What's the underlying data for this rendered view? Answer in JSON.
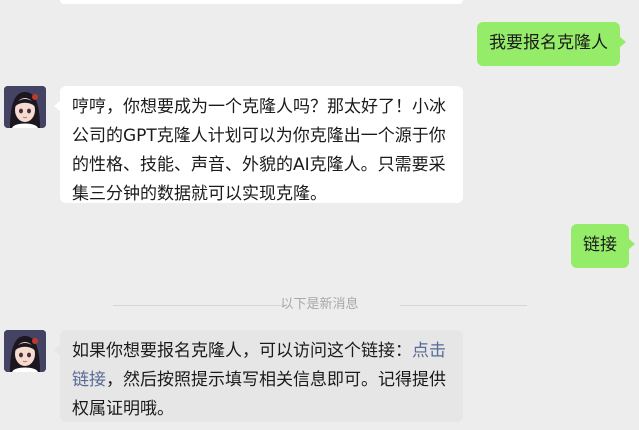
{
  "chat": {
    "messages": [
      {
        "side": "right",
        "text": "我要报名克隆人"
      },
      {
        "side": "left",
        "avatar": "anime-girl-avatar",
        "text": "哼哼，你想要成为一个克隆人吗？那太好了！小冰公司的GPT克隆人计划可以为你克隆出一个源于你的性格、技能、声音、外貌的AI克隆人。只需要采集三分钟的数据就可以实现克隆。"
      },
      {
        "side": "right",
        "text": "链接"
      },
      {
        "side": "left",
        "avatar": "anime-girl-avatar",
        "text_before": "如果你想要报名克隆人，可以访问这个链接：",
        "link_text": "点击链接",
        "text_after": "，然后按照提示填写相关信息即可。记得提供权属证明哦。"
      }
    ],
    "new_messages_divider": "以下是新消息"
  },
  "colors": {
    "background": "#ededed",
    "bubble_self": "#95ec69",
    "bubble_other": "#ffffff",
    "bubble_highlight": "#e6e6e6",
    "link": "#576b95"
  }
}
